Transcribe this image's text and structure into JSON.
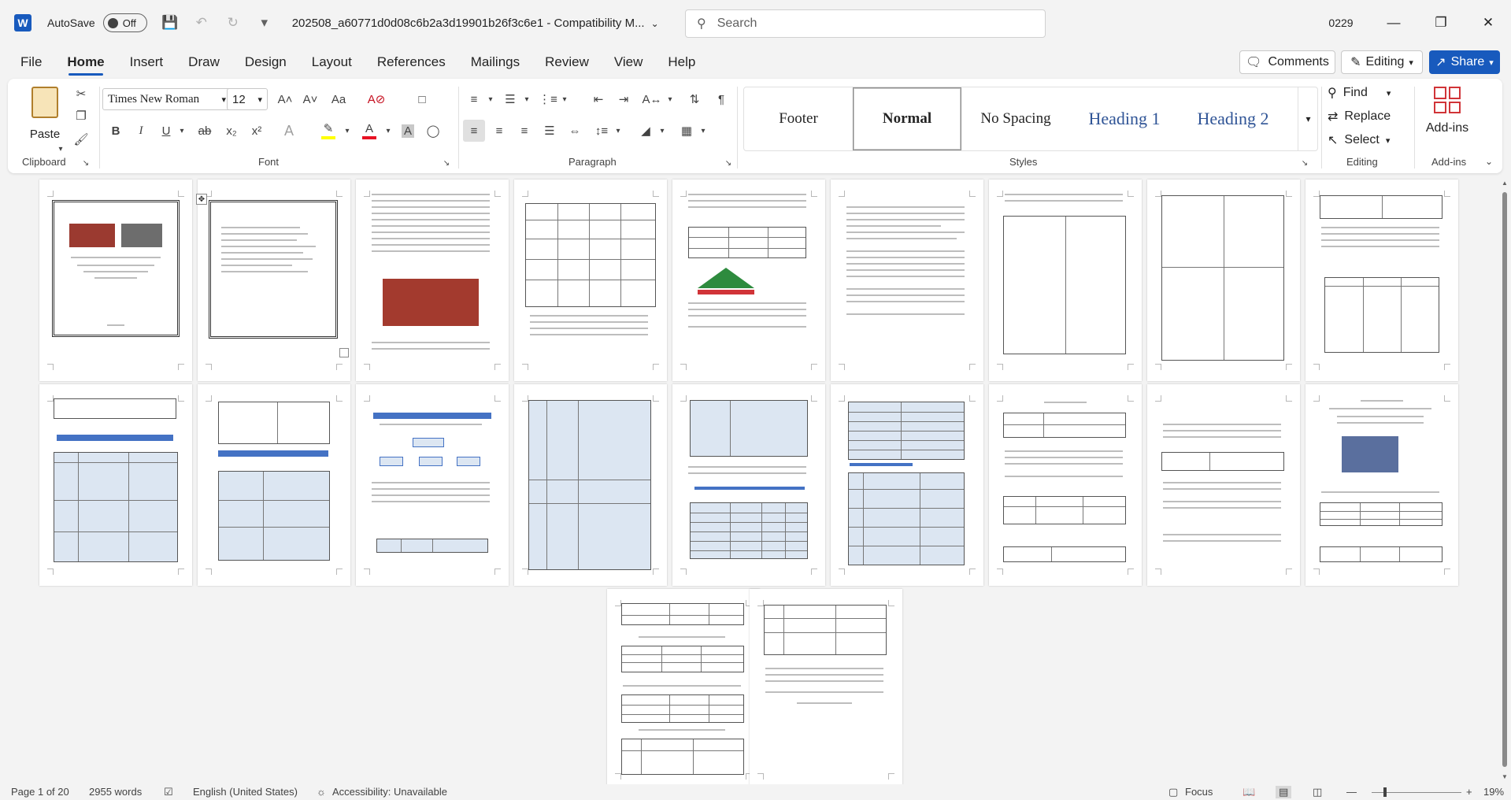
{
  "app": {
    "logo_letter": "W",
    "autosave_label": "AutoSave",
    "autosave_state": "Off",
    "doc_title": "202508_a60771d0d08c6b2a3d19901b26f3c6e1  -  Compatibility M...",
    "search_placeholder": "Search",
    "user_badge": "0229"
  },
  "tabs": [
    "File",
    "Home",
    "Insert",
    "Draw",
    "Design",
    "Layout",
    "References",
    "Mailings",
    "Review",
    "View",
    "Help"
  ],
  "active_tab": "Home",
  "actions": {
    "comments": "Comments",
    "editing": "Editing",
    "share": "Share"
  },
  "ribbon": {
    "clipboard": {
      "label": "Clipboard",
      "paste": "Paste"
    },
    "font": {
      "label": "Font",
      "family": "Times New Roman",
      "size": "12",
      "grow": "A˄",
      "shrink": "A˅",
      "case": "Aa",
      "bold": "B",
      "italic": "I",
      "underline": "U",
      "strike": "ab",
      "subscript": "x₂",
      "superscript": "x²"
    },
    "paragraph": {
      "label": "Paragraph"
    },
    "styles": {
      "label": "Styles",
      "items": [
        "Footer",
        "Normal",
        "No Spacing",
        "Heading 1",
        "Heading 2"
      ],
      "selected": "Normal"
    },
    "editing": {
      "label": "Editing",
      "find": "Find",
      "replace": "Replace",
      "select": "Select"
    },
    "addins": {
      "label": "Add-ins",
      "button": "Add-ins"
    }
  },
  "status": {
    "page": "Page 1 of 20",
    "words": "2955 words",
    "language": "English (United States)",
    "accessibility": "Accessibility: Unavailable",
    "focus": "Focus",
    "zoom": "19%",
    "zoom_level": 0.19
  },
  "colors": {
    "accent": "#185abd",
    "font_color_bar": "#e81123",
    "highlight_bar": "#ffff00",
    "heading_style": "#2f5496"
  }
}
